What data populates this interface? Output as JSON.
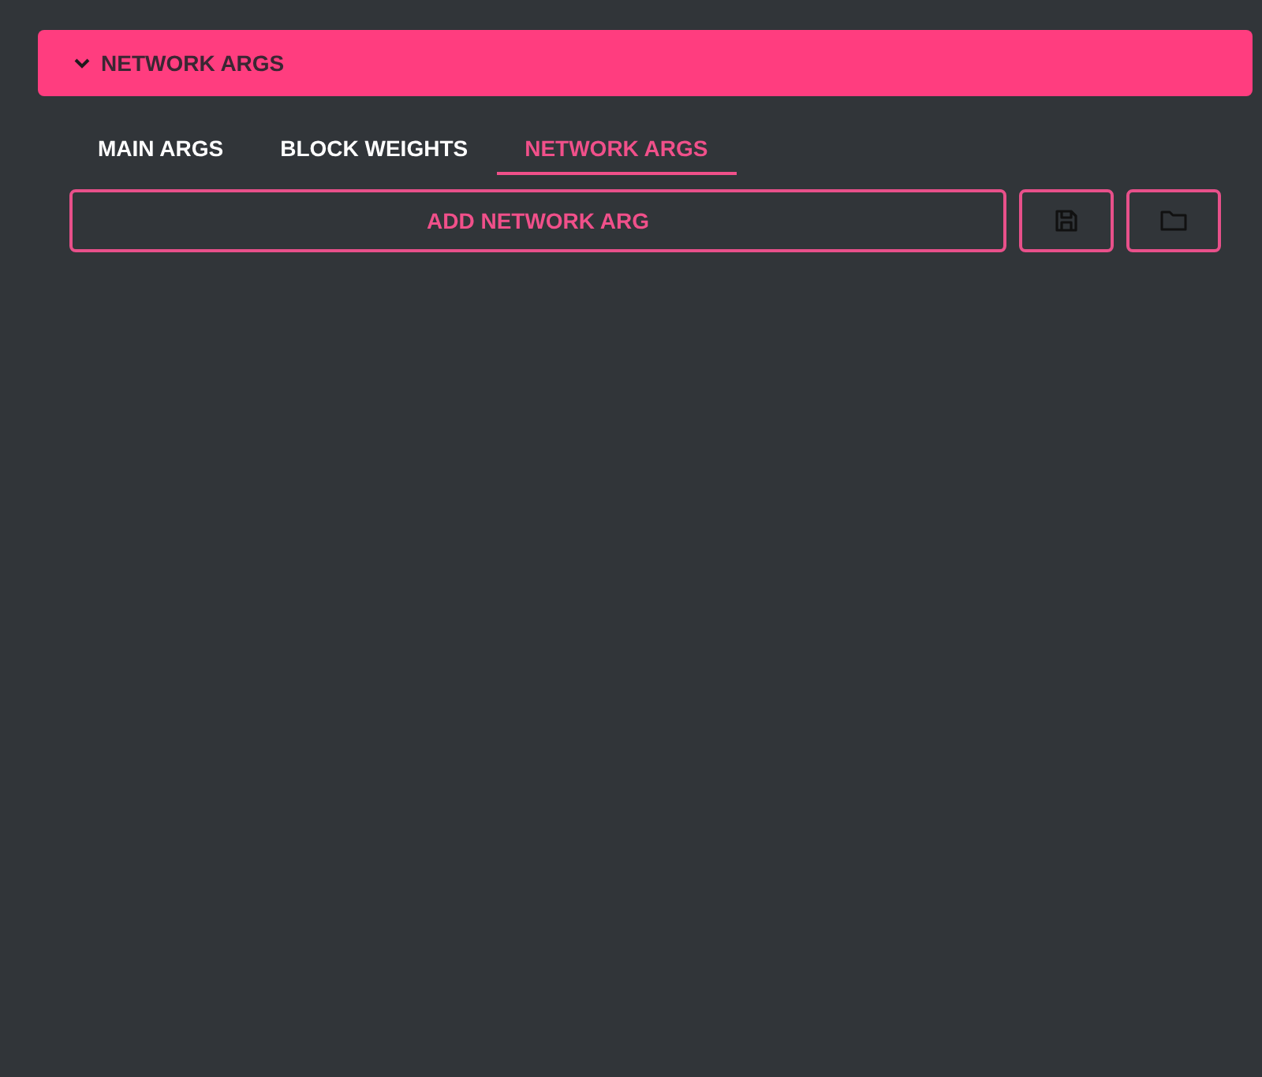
{
  "section": {
    "title": "NETWORK ARGS",
    "expanded": true
  },
  "tabs": [
    {
      "label": "MAIN ARGS",
      "selected": false
    },
    {
      "label": "BLOCK WEIGHTS",
      "selected": false
    },
    {
      "label": "NETWORK ARGS",
      "selected": true
    }
  ],
  "actions": {
    "add_label": "ADD NETWORK ARG"
  }
}
